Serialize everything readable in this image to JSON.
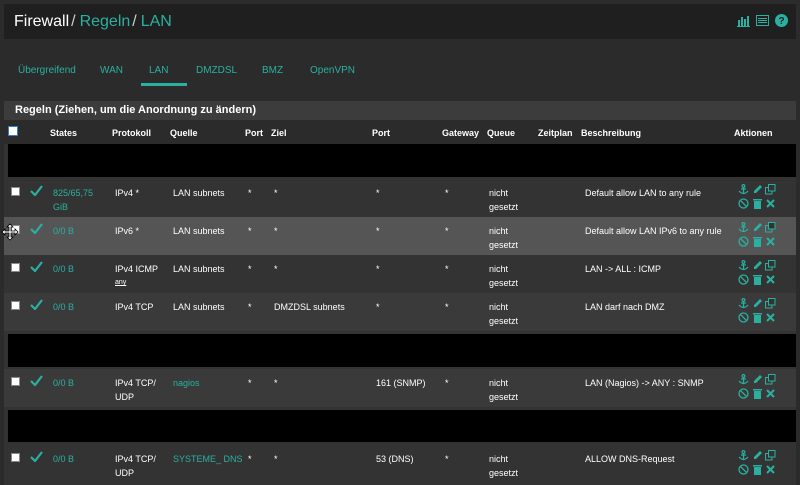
{
  "breadcrumb": [
    "Firewall",
    "Regeln",
    "LAN"
  ],
  "separators": [
    "/",
    "/"
  ],
  "tabs": [
    "Übergreifend",
    "WAN",
    "LAN",
    "DMZDSL",
    "BMZ",
    "OpenVPN"
  ],
  "active_tab": "LAN",
  "panel_title": "Regeln (Ziehen, um die Anordnung zu ändern)",
  "columns": [
    "States",
    "Protokoll",
    "Quelle",
    "Port",
    "Ziel",
    "Port",
    "Gateway",
    "Queue",
    "Zeitplan",
    "Beschreibung",
    "Aktionen"
  ],
  "colors": {
    "accent": "#2ab0a0",
    "bg": "#2b2b2b",
    "row_dark": "#333333",
    "row_light": "#555555",
    "black_band": "#000000"
  },
  "rows": [
    {
      "states": "825/65,75 GiB",
      "protocol": "IPv4 *",
      "protocol_sub": "",
      "source": "LAN subnets",
      "sport": "*",
      "dest": "*",
      "dport": "*",
      "gateway": "*",
      "queue": "nicht gesetzt",
      "schedule": "",
      "description": "Default allow LAN to any rule",
      "source_link": false
    },
    {
      "states": "0/0 B",
      "protocol": "IPv6 *",
      "protocol_sub": "",
      "source": "LAN subnets",
      "sport": "*",
      "dest": "*",
      "dport": "*",
      "gateway": "*",
      "queue": "nicht gesetzt",
      "schedule": "",
      "description": "Default allow LAN IPv6 to any rule",
      "source_link": false
    },
    {
      "states": "0/0 B",
      "protocol": "IPv4 ICMP",
      "protocol_sub": "any",
      "source": "LAN subnets",
      "sport": "*",
      "dest": "*",
      "dport": "*",
      "gateway": "*",
      "queue": "nicht gesetzt",
      "schedule": "",
      "description": "LAN -> ALL : ICMP",
      "source_link": false
    },
    {
      "states": "0/0 B",
      "protocol": "IPv4 TCP",
      "protocol_sub": "",
      "source": "LAN subnets",
      "sport": "*",
      "dest": "DMZDSL subnets",
      "dport": "*",
      "gateway": "*",
      "queue": "nicht gesetzt",
      "schedule": "",
      "description": "LAN darf nach DMZ",
      "source_link": false
    },
    {
      "states": "0/0 B",
      "protocol": "IPv4 TCP/ UDP",
      "protocol_sub": "",
      "source": "nagios",
      "sport": "*",
      "dest": "*",
      "dport": "161 (SNMP)",
      "gateway": "*",
      "queue": "nicht gesetzt",
      "schedule": "",
      "description": "LAN (Nagios) -> ANY : SNMP",
      "source_link": true
    },
    {
      "states": "0/0 B",
      "protocol": "IPv4 TCP/ UDP",
      "protocol_sub": "",
      "source": "SYSTEME_ DNS",
      "sport": "*",
      "dest": "*",
      "dport": "53 (DNS)",
      "gateway": "*",
      "queue": "nicht gesetzt",
      "schedule": "",
      "description": "ALLOW DNS-Request",
      "source_link": true
    }
  ]
}
